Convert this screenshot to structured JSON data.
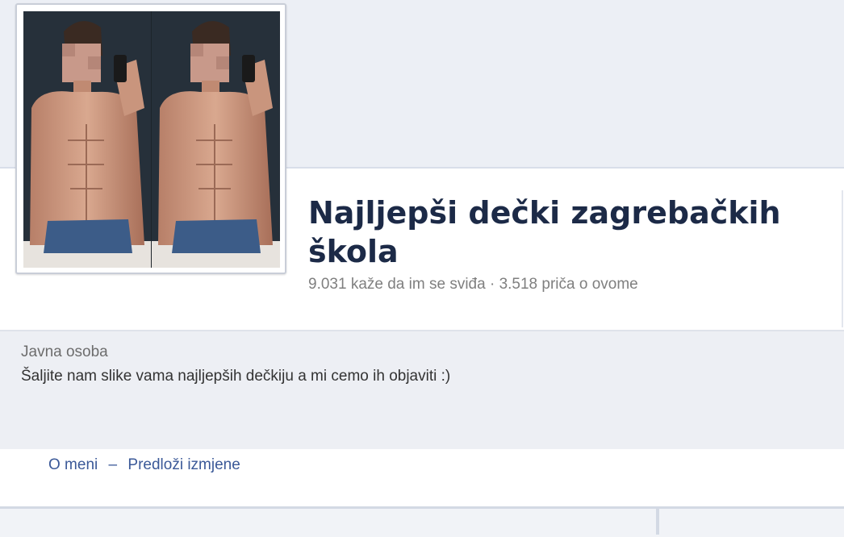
{
  "page": {
    "title": "Najljepši dečki zagrebačkih škola",
    "stats": "9.031 kaže da im se sviđa · 3.518 priča o ovome"
  },
  "about": {
    "category": "Javna osoba",
    "description": "Šaljite nam slike vama najljepših dečkiju a mi cemo ih objaviti :)"
  },
  "links": {
    "about_label": "O meni",
    "separator": "–",
    "suggest_label": "Predloži izmjene"
  },
  "colors": {
    "title": "#1c2a47",
    "link": "#3b5998",
    "muted": "#7f7f7f",
    "band": "#edeff4"
  }
}
